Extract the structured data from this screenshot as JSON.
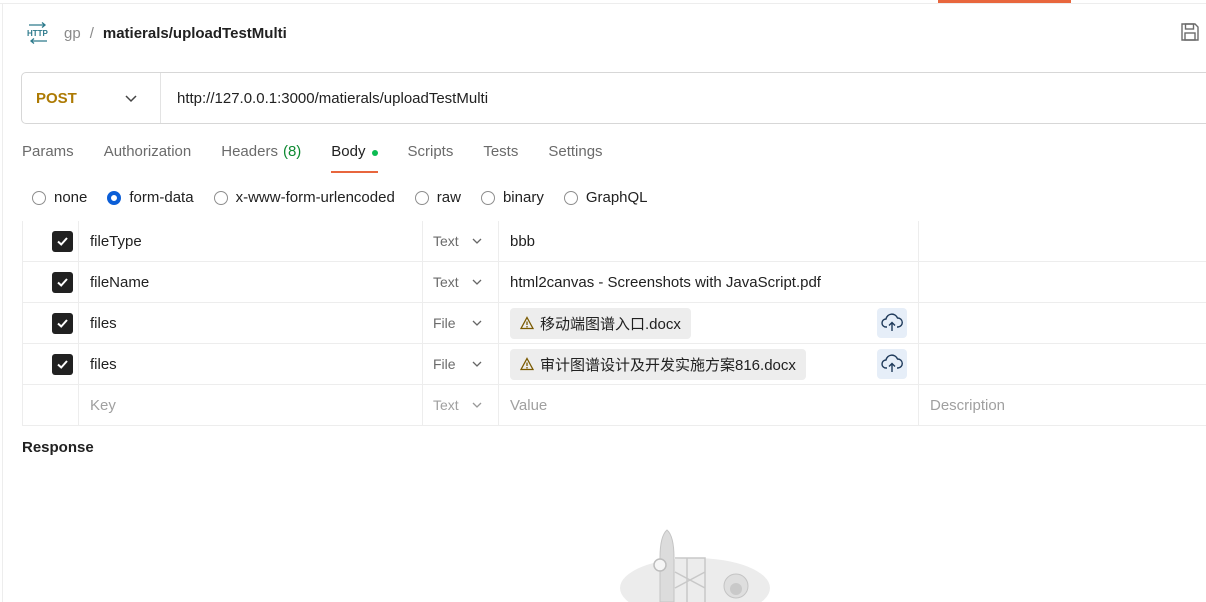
{
  "breadcrumb": {
    "parent": "gp",
    "separator": "/",
    "current": "matierals/uploadTestMulti"
  },
  "request": {
    "method": "POST",
    "url": "http://127.0.0.1:3000/matierals/uploadTestMulti"
  },
  "tabs": [
    {
      "label": "Params"
    },
    {
      "label": "Authorization"
    },
    {
      "label": "Headers",
      "count": "(8)"
    },
    {
      "label": "Body",
      "active": true
    },
    {
      "label": "Scripts"
    },
    {
      "label": "Tests"
    },
    {
      "label": "Settings"
    }
  ],
  "body_types": [
    {
      "label": "none",
      "selected": false
    },
    {
      "label": "form-data",
      "selected": true
    },
    {
      "label": "x-www-form-urlencoded",
      "selected": false
    },
    {
      "label": "raw",
      "selected": false
    },
    {
      "label": "binary",
      "selected": false
    },
    {
      "label": "GraphQL",
      "selected": false
    }
  ],
  "form_rows": [
    {
      "key": "fileType",
      "type": "Text",
      "value": "bbb",
      "checked": true
    },
    {
      "key": "fileName",
      "type": "Text",
      "value": "html2canvas - Screenshots with JavaScript.pdf",
      "checked": true
    },
    {
      "key": "files",
      "type": "File",
      "value": "移动端图谱入口.docx",
      "checked": true
    },
    {
      "key": "files",
      "type": "File",
      "value": "审计图谱设计及开发实施方案816.docx",
      "checked": true
    }
  ],
  "new_row": {
    "key_placeholder": "Key",
    "type": "Text",
    "value_placeholder": "Value",
    "description_placeholder": "Description"
  },
  "response": {
    "title": "Response"
  },
  "colors": {
    "accent": "#e8663d",
    "method": "#ad7a03",
    "radio_selected": "#0b5ed7",
    "body_dot": "#0cbb52",
    "header_count": "#0e8a32"
  }
}
